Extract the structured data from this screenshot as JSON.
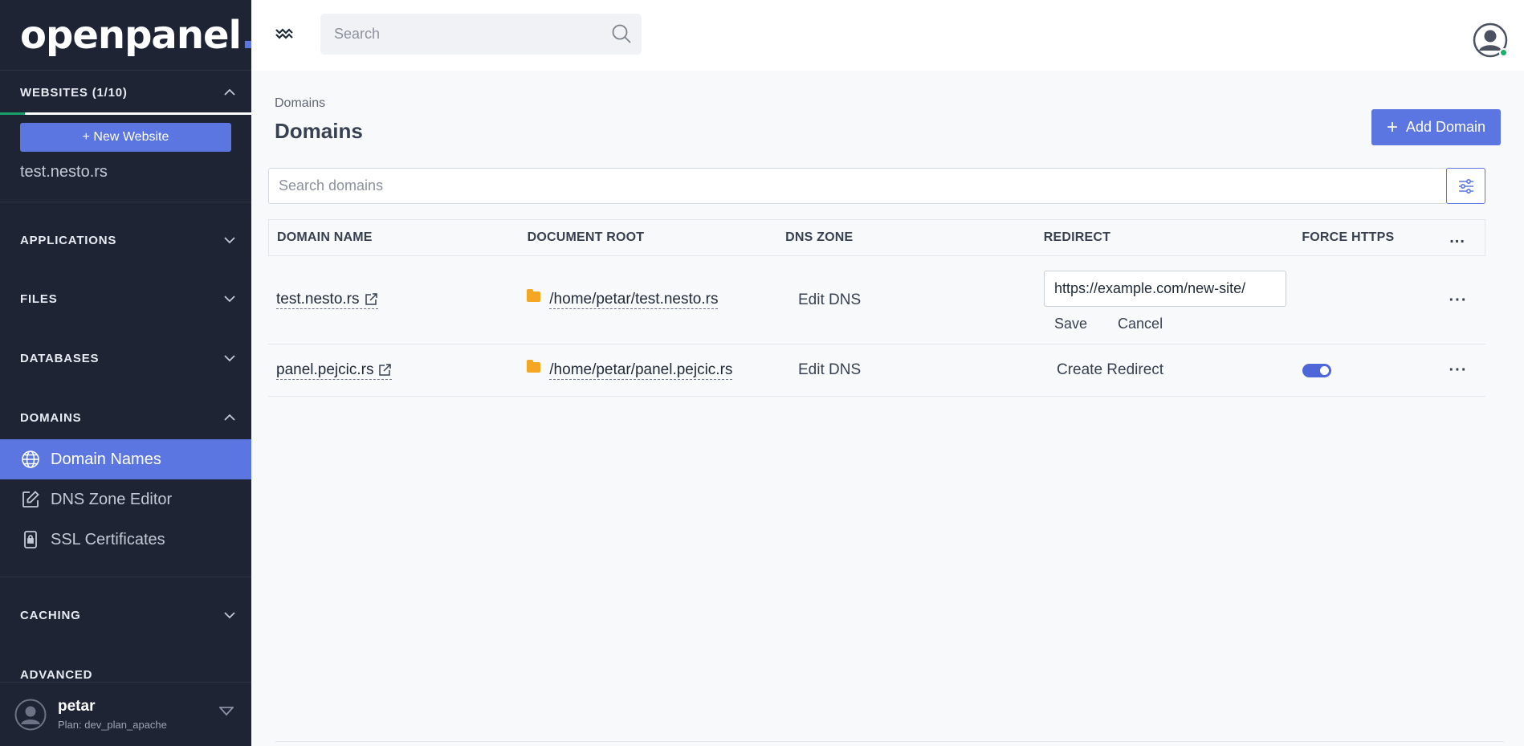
{
  "brand": {
    "name": "openpanel",
    "dot": "."
  },
  "sidebar": {
    "websites": {
      "label": "WEBSITES (1/10)",
      "usage": 0.1,
      "new_label": "+ New Website",
      "site": "test.nesto.rs"
    },
    "sections": [
      {
        "label": "APPLICATIONS"
      },
      {
        "label": "FILES"
      },
      {
        "label": "DATABASES"
      }
    ],
    "domains": {
      "label": "DOMAINS",
      "items": [
        {
          "label": "Domain Names",
          "icon": "globe-icon",
          "active": true
        },
        {
          "label": "DNS Zone Editor",
          "icon": "edit-icon",
          "active": false
        },
        {
          "label": "SSL Certificates",
          "icon": "lock-icon",
          "active": false
        }
      ]
    },
    "caching": {
      "label": "CACHING"
    },
    "advanced": {
      "label": "ADVANCED"
    },
    "user": {
      "name": "petar",
      "plan": "Plan: dev_plan_apache"
    }
  },
  "topbar": {
    "search_placeholder": "Search"
  },
  "main": {
    "breadcrumb": "Domains",
    "title": "Domains",
    "add_button": "Add Domain",
    "search_placeholder": "Search domains",
    "columns": [
      "DOMAIN NAME",
      "DOCUMENT ROOT",
      "DNS ZONE",
      "REDIRECT",
      "FORCE HTTPS",
      "..."
    ],
    "rows": [
      {
        "domain": "test.nesto.rs",
        "docroot": "/home/petar/test.nesto.rs",
        "dns": "Edit DNS",
        "redirect_value": "https://example.com/new-site/",
        "save": "Save",
        "cancel": "Cancel",
        "force_https": null
      },
      {
        "domain": "panel.pejcic.rs",
        "docroot": "/home/petar/panel.pejcic.rs",
        "dns": "Edit DNS",
        "redirect": "Create Redirect",
        "force_https": true
      }
    ]
  },
  "colors": {
    "accent": "#5b76e0",
    "sidebar": "#1e2433",
    "online": "#17b26a",
    "folder": "#f5a623"
  }
}
